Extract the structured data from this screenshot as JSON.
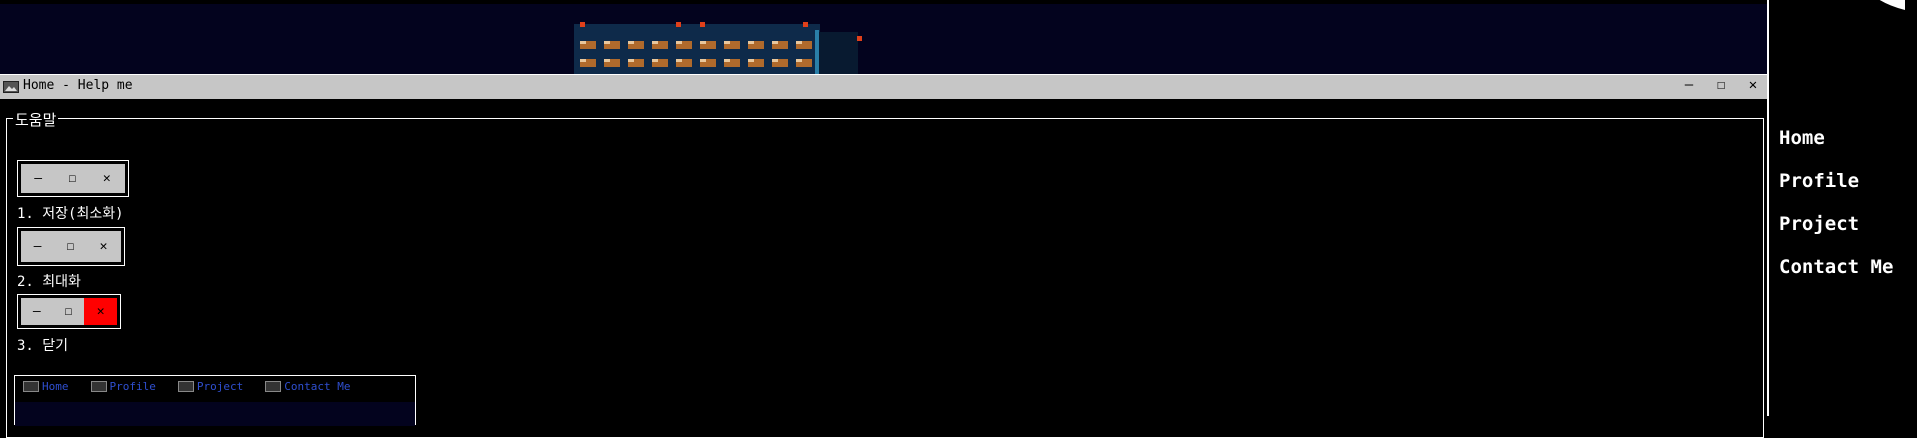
{
  "window": {
    "title": "Home - Help me",
    "minimize_symbol": "–",
    "maximize_symbol": "☐",
    "close_symbol": "✕"
  },
  "sidebar": {
    "items": [
      {
        "label": "Home"
      },
      {
        "label": "Profile"
      },
      {
        "label": "Project"
      },
      {
        "label": "Contact Me"
      }
    ]
  },
  "help": {
    "legend": "도움말",
    "steps": [
      {
        "label": "1. 저장(최소화)",
        "highlight": "minimize"
      },
      {
        "label": "2. 최대화",
        "highlight": "maximize"
      },
      {
        "label": "3. 닫기",
        "highlight": "close"
      }
    ],
    "demo_buttons": [
      "–",
      "☐",
      "✕"
    ],
    "mini_nav": [
      "Home",
      "Profile",
      "Project",
      "Contact Me"
    ]
  },
  "colors": {
    "titlebar": "#c6c6c6",
    "close_highlight": "#ff0000",
    "mini_nav_text": "#2f4fd0",
    "banner_bg": "#03031e"
  }
}
